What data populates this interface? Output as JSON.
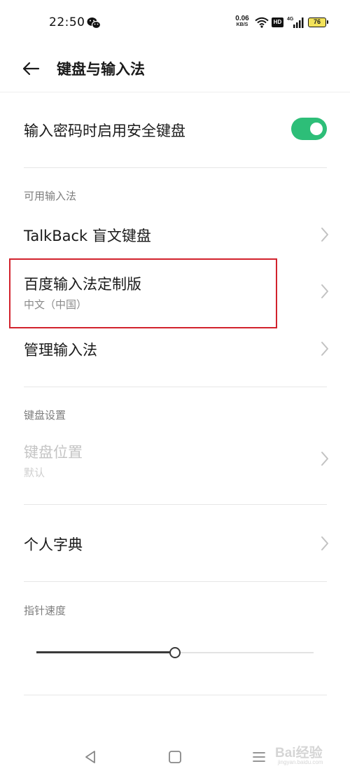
{
  "status_bar": {
    "time": "22:50",
    "net_speed_value": "0.06",
    "net_speed_unit": "KB/S",
    "hd_label": "HD",
    "signal_label": "4G",
    "battery": "76",
    "icons": [
      "wechat-icon",
      "wifi-icon",
      "signal-icon",
      "battery-icon"
    ]
  },
  "header": {
    "title": "键盘与输入法",
    "back_icon": "back-arrow-icon"
  },
  "secure_keyboard": {
    "label": "输入密码时启用安全键盘",
    "enabled": true
  },
  "available_ime": {
    "section_label": "可用输入法",
    "items": [
      {
        "title": "TalkBack 盲文键盘"
      },
      {
        "title": "百度输入法定制版",
        "subtitle": "中文（中国）"
      },
      {
        "title": "管理输入法"
      }
    ]
  },
  "keyboard_settings": {
    "section_label": "键盘设置",
    "position": {
      "title": "键盘位置",
      "subtitle": "默认",
      "disabled": true
    }
  },
  "personal_dictionary": {
    "title": "个人字典"
  },
  "pointer_speed": {
    "section_label": "指针速度",
    "value_fraction": 0.5
  },
  "nav_bar": {
    "icons": [
      "nav-back-icon",
      "nav-home-icon",
      "nav-menu-icon"
    ]
  },
  "watermark": {
    "text": "Bai经验",
    "url": "jingyan.baidu.com"
  },
  "colors": {
    "toggle_on": "#2dbe78",
    "highlight": "#d2222d",
    "battery": "#f2e25a"
  }
}
